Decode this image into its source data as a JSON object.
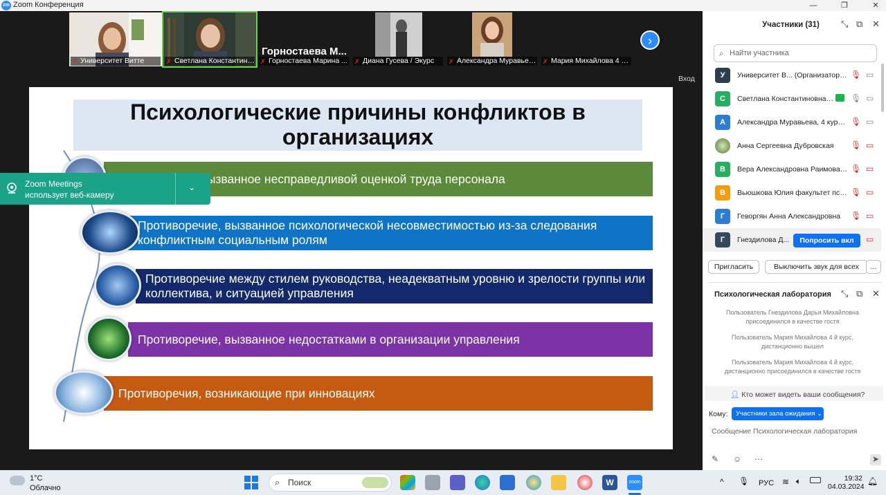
{
  "titlebar": {
    "title": "Zoom Конференция",
    "logo": "zm"
  },
  "thumbnails": [
    {
      "name": "Университет Витте"
    },
    {
      "name": "Светлана Константиновн..."
    },
    {
      "name": "Горностаева Марина ...",
      "big_label": "Горностаева М..."
    },
    {
      "name": "Диана Гусева / Экурс"
    },
    {
      "name": "Александра Муравьев..."
    },
    {
      "name": "Мария Михайлова 4 й..."
    }
  ],
  "share": {
    "entry_label": "Вход"
  },
  "slide": {
    "title": "Психологические причины конфликтов в организациях",
    "items": [
      {
        "text": "Противоречие, вызванное несправедливой оценкой труда персонала",
        "color": "#5b8a3a"
      },
      {
        "text": "Противоречие, вызванное психологической несовместимостью из-за следования конфликтным социальным ролям",
        "color": "#0f74c6"
      },
      {
        "text": "Противоречие между стилем руководства, неадекватным уровню и зрелости группы или коллектива, и ситуацией управления",
        "color": "#13296b"
      },
      {
        "text": "Противоречие, вызванное недостатками в организации управления",
        "color": "#7b33a6"
      },
      {
        "text": "Противоречия, возникающие при инновациях",
        "color": "#c55a11"
      }
    ]
  },
  "toast": {
    "line1": "Zoom Meetings",
    "line2": "использует веб-камеру"
  },
  "participants": {
    "title": "Участники (31)",
    "search_placeholder": "Найти участника",
    "list": [
      {
        "initial": "У",
        "color": "#2c3e50",
        "name": "Университет В... (Организатор, я)"
      },
      {
        "initial": "С",
        "color": "#27ae60",
        "name": "Светлана Константиновна ..."
      },
      {
        "initial": "А",
        "color": "#2d7dd2",
        "name": "Александра Муравьева, 4 курс, ..."
      },
      {
        "initial": "",
        "color": "#6a8f4e",
        "name": "Анна Сергеевна Дубровская"
      },
      {
        "initial": "В",
        "color": "#27ae60",
        "name": "Вера Александровна Раимова ..."
      },
      {
        "initial": "В",
        "color": "#f39c12",
        "name": "Вьюшкова Юлия факультет пси..."
      },
      {
        "initial": "Г",
        "color": "#2d7dd2",
        "name": "Геворгян Анна Александровна"
      },
      {
        "initial": "Г",
        "color": "#34495e",
        "name": "Гнездилова Д..."
      }
    ],
    "ask_button": "Попросить вкл",
    "invite_button": "Пригласить",
    "mute_all_button": "Выключить звук для всех",
    "more_button": "..."
  },
  "chat": {
    "title": "Психологическая лаборатория",
    "messages": [
      "Пользователь Гнездилова Дарья Михайловна присоединился в качестве гостя",
      "Пользователь Мария Михайлова 4 й курс, дистанционно вышел",
      "Пользователь Мария Михайлова 4 й курс, дистанционно присоединился в качестве гостя"
    ],
    "who_can_see": "Кто может видеть ваши сообщения?",
    "to_label": "Кому:",
    "to_value": "Участники зала ожидания",
    "message_placeholder": "Сообщение Психологическая лаборатория"
  },
  "taskbar": {
    "temp": "1°C",
    "weather": "Облачно",
    "search": "Поиск",
    "lang": "РУС",
    "time": "19:32",
    "date": "04.03.2024"
  }
}
